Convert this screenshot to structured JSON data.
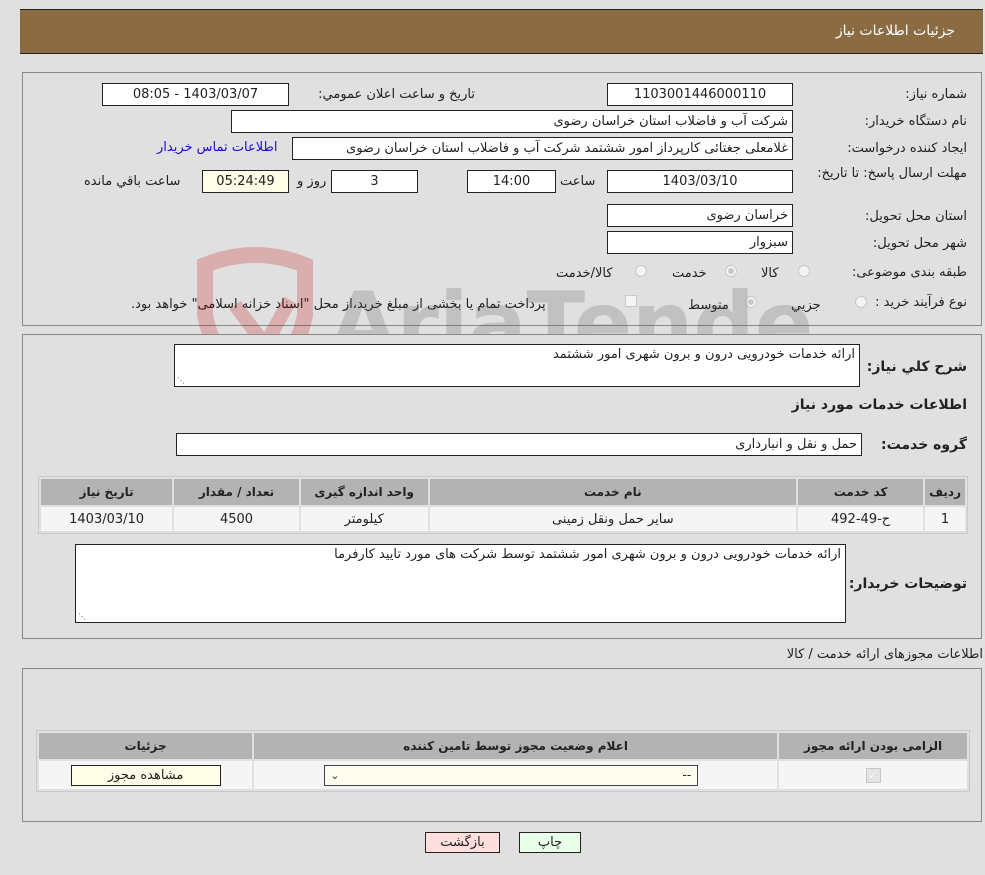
{
  "header": {
    "title": "جزئیات اطلاعات نیاز"
  },
  "form": {
    "need_number": {
      "label": "شماره نیاز:",
      "value": "1103001446000110"
    },
    "announce_datetime": {
      "label": "تاریخ و ساعت اعلان عمومي:",
      "value": "1403/03/07 - 08:05"
    },
    "buyer_org": {
      "label": "نام دستگاه خريدار:",
      "value": "شرکت آب و فاضلاب استان خراسان رضوی"
    },
    "requester": {
      "label": "ايجاد كننده درخواست:",
      "value": "غلامعلی جغتائی کارپرداز امور ششتمد  شرکت آب و فاضلاب استان خراسان رضوی",
      "contact_link": "اطلاعات تماس خريدار"
    },
    "deadline": {
      "label": "مهلت ارسال پاسخ: تا تاريخ:",
      "date": "1403/03/10",
      "time_label": "ساعت",
      "time": "14:00",
      "days": "3",
      "days_label": "روز و",
      "remaining": "05:24:49",
      "remaining_label": "ساعت باقي مانده"
    },
    "delivery_province": {
      "label": "استان محل تحويل:",
      "value": "خراسان رضوی"
    },
    "delivery_city": {
      "label": "شهر محل تحويل:",
      "value": "سبزوار"
    },
    "category": {
      "label": "طبقه بندی موضوعی:",
      "options": [
        {
          "label": "کالا",
          "checked": false
        },
        {
          "label": "خدمت",
          "checked": true
        },
        {
          "label": "کالا/خدمت",
          "checked": false
        }
      ]
    },
    "process_type": {
      "label": "نوع فرآيند خريد :",
      "options": [
        {
          "label": "جزيي",
          "checked": false
        },
        {
          "label": "متوسط",
          "checked": true
        }
      ],
      "treasury_note": "پرداخت تمام يا بخشی از مبلغ خريد،از محل \"اسناد خزانه اسلامی\" خواهد بود.",
      "treasury_checked": false
    }
  },
  "summary": {
    "label": "شرح کلي نياز:",
    "value": "ارائه خدمات خودرويی درون و برون شهری امور ششتمد",
    "services_heading": "اطلاعات خدمات مورد نياز",
    "service_group_label": "گروه خدمت:",
    "service_group_value": "حمل و نقل و انبارداری"
  },
  "services_table": {
    "headers": [
      "رديف",
      "کد خدمت",
      "نام خدمت",
      "واحد اندازه گيری",
      "تعداد / مقدار",
      "تاريخ نياز"
    ],
    "rows": [
      [
        "1",
        "ح-49-492",
        "ساير حمل ونقل زمينی",
        "کيلومتر",
        "4500",
        "1403/03/10"
      ]
    ]
  },
  "buyer_notes": {
    "label": "توضيحات خريدار:",
    "value": "ارائه خدمات خودرويی درون و برون شهری امور ششتمد توسط شرکت های مورد تاييد کارفرما"
  },
  "permits": {
    "title": "اطلاعات مجوزهای ارائه خدمت / کالا",
    "headers": [
      "الزامی بودن ارائه مجوز",
      "اعلام وضعيت مجوز توسط تامين کننده",
      "جزئيات"
    ],
    "row": {
      "required_checked": true,
      "status_selected": "--",
      "details_button": "مشاهده مجوز"
    }
  },
  "actions": {
    "print": "چاپ",
    "back": "بازگشت"
  },
  "watermark": {
    "text": "AriaTender.neT"
  },
  "colors": {
    "header": "#8b6c42",
    "print_btn": "#eaffea",
    "back_btn": "#ffdede",
    "link": "#1a0dcc"
  }
}
